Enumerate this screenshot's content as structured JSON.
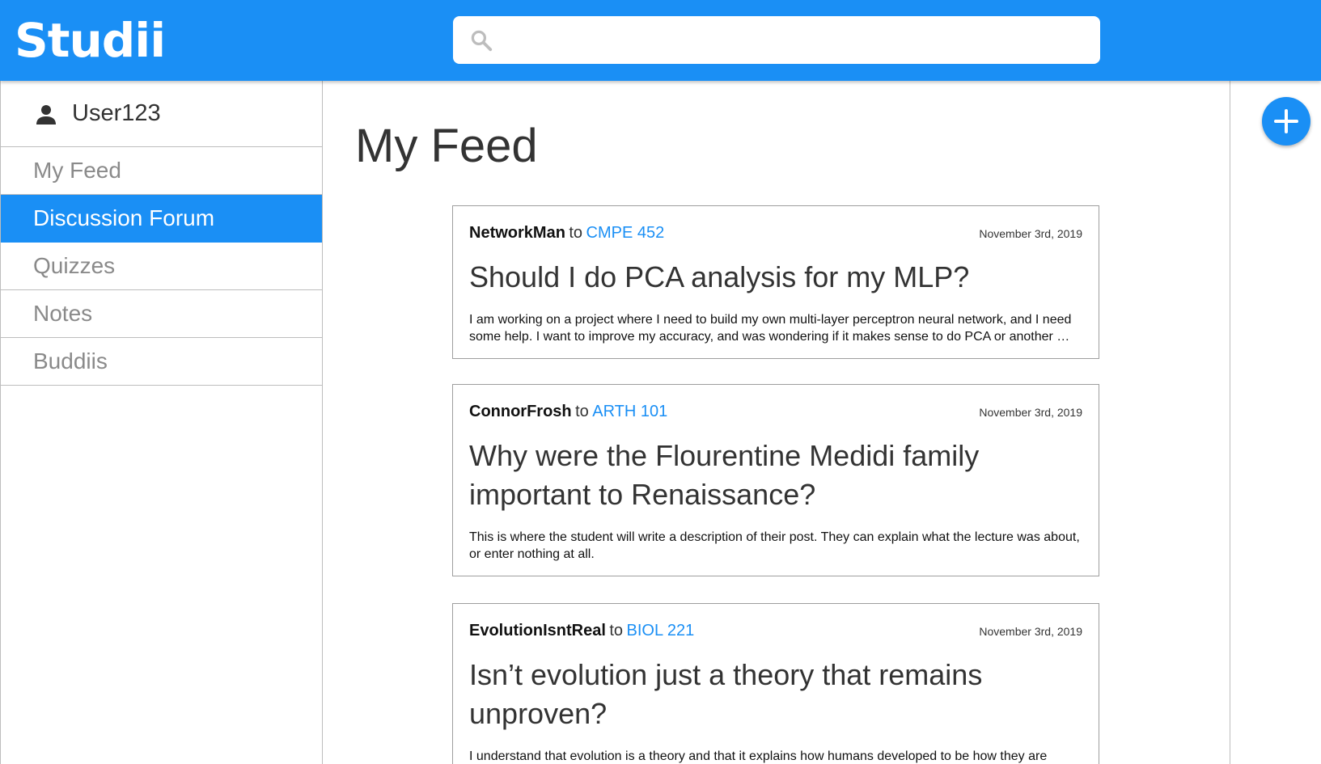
{
  "app": {
    "logo": "Studii"
  },
  "search": {
    "value": "",
    "placeholder": ""
  },
  "user": {
    "name": "User123"
  },
  "sidebar": {
    "items": [
      {
        "label": "My Feed",
        "active": false
      },
      {
        "label": "Discussion Forum",
        "active": true
      },
      {
        "label": "Quizzes",
        "active": false
      },
      {
        "label": "Notes",
        "active": false
      },
      {
        "label": "Buddiis",
        "active": false
      }
    ]
  },
  "main": {
    "title": "My Feed",
    "posts": [
      {
        "author": "NetworkMan",
        "to": "to",
        "course": "CMPE 452",
        "date": "November 3rd, 2019",
        "title": "Should I do PCA analysis for my MLP?",
        "body": "I am working on a project where I need to build my own multi-layer perceptron neural network, and I need some help. I want to improve my accuracy, and was wondering if it makes sense to do PCA or another …"
      },
      {
        "author": "ConnorFrosh",
        "to": "to",
        "course": "ARTH 101",
        "date": "November 3rd, 2019",
        "title": "Why were the Flourentine Medidi family important to Renaissance?",
        "body": "This is where the student will write a description of their post. They can explain what the lecture was about, or enter nothing at all."
      },
      {
        "author": "EvolutionIsntReal",
        "to": "to",
        "course": "BIOL 221",
        "date": "November 3rd, 2019",
        "title": "Isn’t evolution just a theory that remains unproven?",
        "body": "I understand that evolution is a theory and that it explains how humans developed to be how they are today."
      }
    ]
  },
  "colors": {
    "accent": "#1a8ff5",
    "border": "#bdbdbd",
    "muted_text": "#8a8a8a"
  },
  "icons": {
    "search": "search-icon",
    "user": "person-icon",
    "fab": "plus-icon"
  }
}
